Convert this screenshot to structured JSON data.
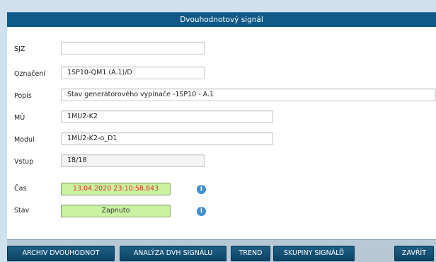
{
  "window": {
    "title": "Dvouhodnotový signál"
  },
  "form": {
    "sjz": {
      "label": "SJZ",
      "value": ""
    },
    "oznaceni": {
      "label": "Označení",
      "value": "1SP10-QM1 (A.1)/D"
    },
    "popis": {
      "label": "Popis",
      "value": "Stav generátorového vypínače -1SP10 - A.1"
    },
    "mu": {
      "label": "MÚ",
      "value": "1MU2-K2"
    },
    "modul": {
      "label": "Modul",
      "value": "1MU2-K2-o_D1"
    },
    "vstup": {
      "label": "Vstup",
      "value": "18/18"
    },
    "cas": {
      "label": "Čas",
      "value": "13.04.2020  23:10:58.843",
      "icon": "info-icon"
    },
    "stav": {
      "label": "Stav",
      "value": "Zapnuto",
      "icon": "info-icon"
    }
  },
  "colors": {
    "titlebar": "#0f5a88",
    "accent_green": "#c9f2a3",
    "time_text": "#e0321c",
    "button": "#0d4466"
  },
  "footer": {
    "buttons": [
      {
        "label": "ARCHIV DVOUHODNOT"
      },
      {
        "label": "ANALÝZA DVH SIGNÁLU"
      },
      {
        "label": "TREND"
      },
      {
        "label": "SKUPINY SIGNÁLŮ"
      },
      {
        "label": "ZAVŘÍT"
      }
    ]
  }
}
